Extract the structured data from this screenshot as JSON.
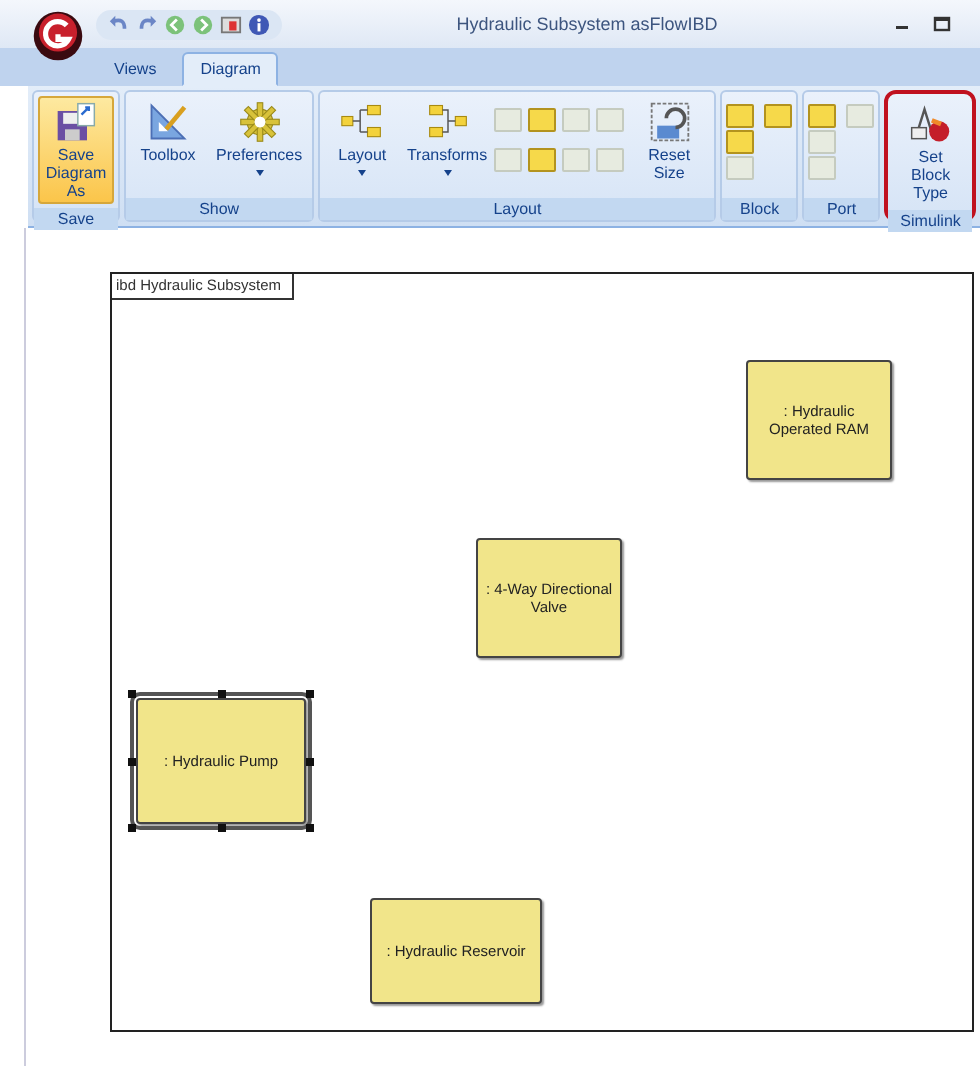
{
  "window": {
    "title": "Hydraulic Subsystem asFlowIBD"
  },
  "tabs": [
    {
      "label": "Views",
      "selected": false
    },
    {
      "label": "Diagram",
      "selected": true
    }
  ],
  "ribbon": [
    {
      "name": "Save",
      "annotated": false,
      "buttons": [
        {
          "kind": "save",
          "label": "Save Diagram As",
          "highlighted": true,
          "dropdown": false
        }
      ]
    },
    {
      "name": "Show",
      "annotated": false,
      "buttons": [
        {
          "kind": "toolbox",
          "label": "Toolbox",
          "highlighted": false,
          "dropdown": false
        },
        {
          "kind": "gear",
          "label": "Preferences",
          "highlighted": false,
          "dropdown": true
        }
      ]
    },
    {
      "name": "Layout",
      "annotated": false,
      "buttons": [
        {
          "kind": "layout",
          "label": "Layout",
          "highlighted": false,
          "dropdown": true
        },
        {
          "kind": "transforms",
          "label": "Transforms",
          "highlighted": false,
          "dropdown": true
        },
        {
          "kind": "small",
          "disabled": true
        },
        {
          "kind": "small",
          "disabled": true
        },
        {
          "kind": "small",
          "disabled": false
        },
        {
          "kind": "small",
          "disabled": false
        },
        {
          "kind": "small",
          "disabled": true
        },
        {
          "kind": "small",
          "disabled": true
        },
        {
          "kind": "small",
          "disabled": true
        },
        {
          "kind": "small",
          "disabled": true
        },
        {
          "kind": "reset",
          "label": "Reset Size",
          "highlighted": false,
          "dropdown": false
        }
      ]
    },
    {
      "name": "Block",
      "annotated": false,
      "buttons": [
        {
          "kind": "small",
          "disabled": false
        },
        {
          "kind": "small",
          "disabled": false
        },
        {
          "kind": "small",
          "disabled": true
        },
        {
          "kind": "small",
          "disabled": false
        }
      ]
    },
    {
      "name": "Port",
      "annotated": false,
      "buttons": [
        {
          "kind": "small",
          "disabled": false
        },
        {
          "kind": "small",
          "disabled": true
        },
        {
          "kind": "small",
          "disabled": true
        },
        {
          "kind": "small",
          "disabled": true
        }
      ]
    },
    {
      "name": "Simulink",
      "annotated": true,
      "buttons": [
        {
          "kind": "simulink",
          "label": "Set Block Type",
          "highlighted": false,
          "dropdown": false
        }
      ]
    }
  ],
  "diagram": {
    "frame_label": "ibd Hydraulic Subsystem",
    "blocks": [
      {
        "label": ": Hydraulic Operated RAM",
        "selected": false
      },
      {
        "label": ": 4-Way Directional Valve",
        "selected": false
      },
      {
        "label": ": Hydraulic Pump",
        "selected": true
      },
      {
        "label": ": Hydraulic Reservoir",
        "selected": false
      }
    ]
  }
}
